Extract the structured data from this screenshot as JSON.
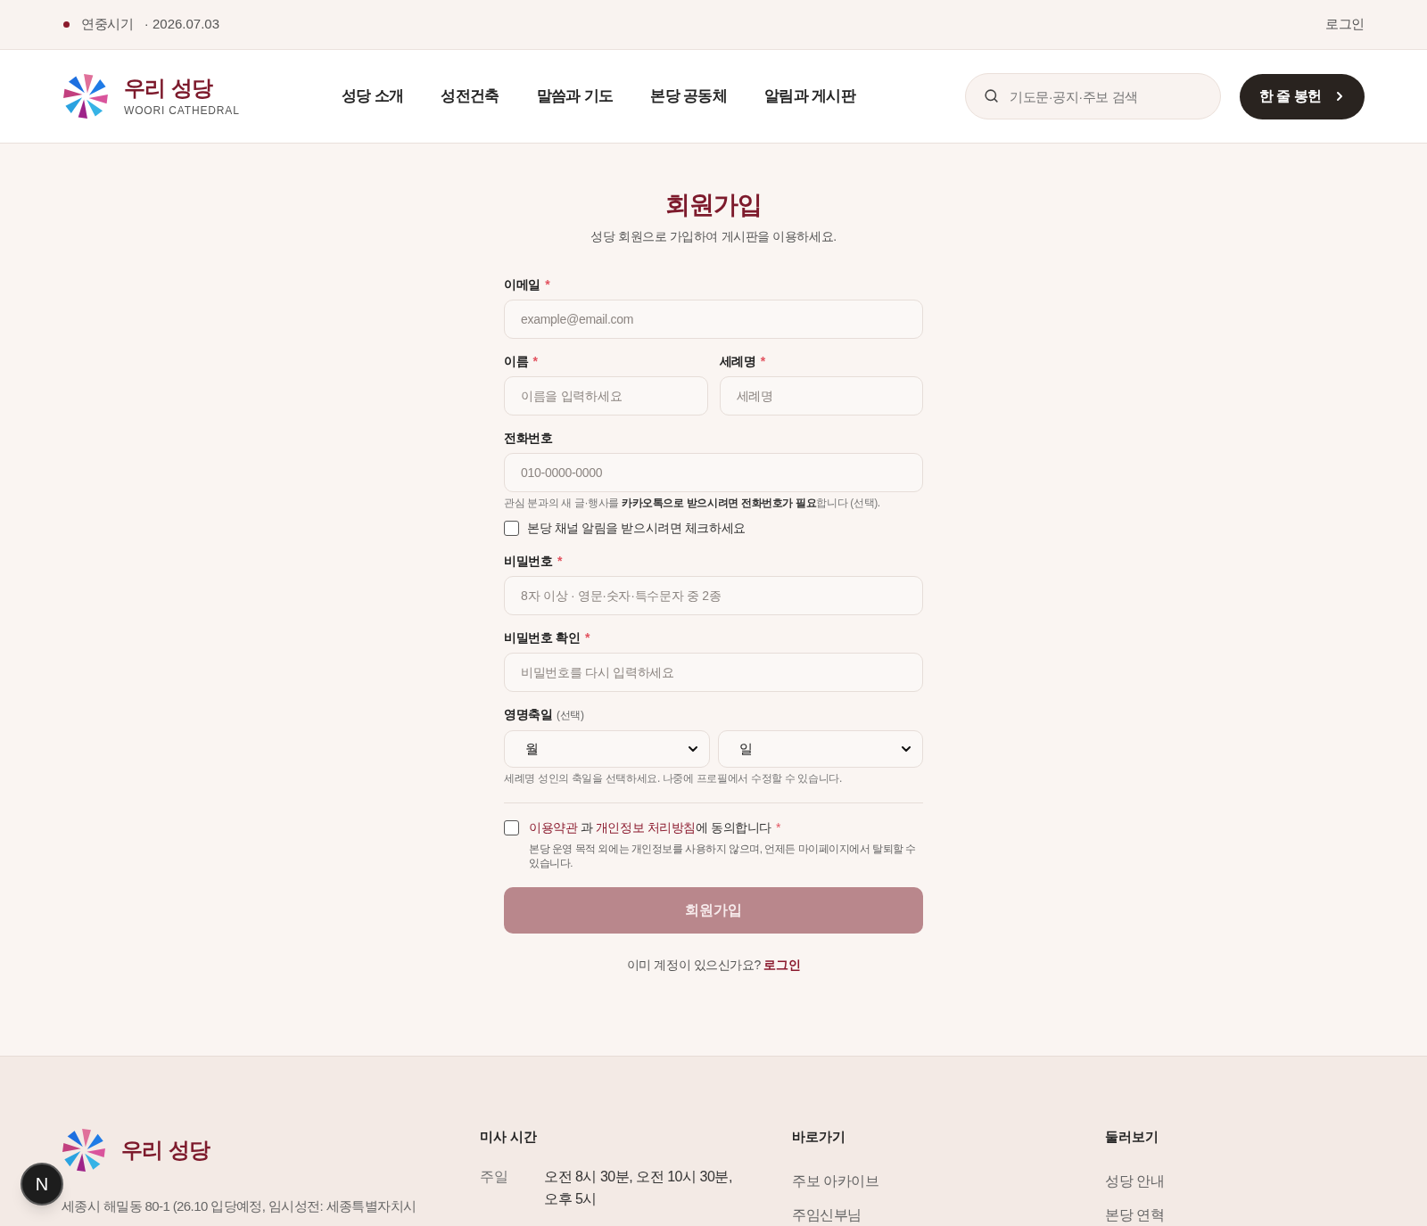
{
  "top_bar": {
    "season": "연중시기",
    "date": "· 2026.07.03",
    "login": "로그인"
  },
  "header": {
    "logo": {
      "name": "우리 성당",
      "subtitle": "WOORI CATHEDRAL"
    },
    "nav": [
      "성당 소개",
      "성전건축",
      "말씀과 기도",
      "본당 공동체",
      "알림과 게시판"
    ],
    "search": {
      "placeholder": "기도문·공지·주보 검색"
    },
    "cta": "한 줄 봉헌"
  },
  "signup": {
    "title": "회원가입",
    "subtitle": "성당 회원으로 가입하여 게시판을 이용하세요.",
    "rows": [
      {
        "kind": "input",
        "label": "이메일",
        "mark": "*",
        "placeholder": "example@email.com"
      },
      {
        "kind": "pair",
        "items": [
          {
            "label": "이름",
            "mark": "*",
            "placeholder": "이름을 입력하세요"
          },
          {
            "label": "세례명",
            "mark": "*",
            "placeholder": "세례명"
          }
        ]
      },
      {
        "kind": "input",
        "label": "전화번호",
        "placeholder": "010-0000-0000",
        "hint": "관심 분과의 새 글·행사를 **카카오톡으로 받으시려면 전화번호가 필요**합니다 (선택)."
      },
      {
        "kind": "checkbox",
        "label": "본당 채널 알림을 받으시려면 체크하세요",
        "checked": false
      },
      {
        "kind": "input",
        "label": "비밀번호",
        "mark": "*",
        "placeholder": "8자 이상 · 영문·숫자·특수문자 중 2종"
      },
      {
        "kind": "input",
        "label": "비밀번호 확인",
        "mark": "*",
        "placeholder": "비밀번호를 다시 입력하세요"
      },
      {
        "kind": "selects",
        "label": "영명축일",
        "note": "(선택)",
        "selects": [
          "월",
          "일"
        ],
        "hint": "세례명 성인의 축일을 선택하세요. 나중에 프로필에서 수정할 수 있습니다."
      }
    ],
    "consent": {
      "checked": false,
      "parts": [
        {
          "kind": "link",
          "text": "이용약관"
        },
        {
          "kind": "text",
          "text": " 과 "
        },
        {
          "kind": "link",
          "text": "개인정보 처리방침"
        },
        {
          "kind": "text",
          "text": "에 동의합니다"
        }
      ],
      "mark": "*",
      "description": "본당 운영 목적 외에는 개인정보를 사용하지 않으며, 언제든 마이페이지에서 탈퇴할 수 있습니다."
    },
    "submit": {
      "label": "회원가입",
      "disabled": true
    },
    "login_prompt": {
      "text": "이미 계정이 있으신가요?",
      "link": "로그인"
    }
  },
  "footer": {
    "logo": {
      "name": "우리 성당"
    },
    "address": "세종시 해밀동 80-1 (26.10 입당예정, 임시성전: 세종특별자치시",
    "mass": {
      "title": "미사 시간",
      "rows": [
        {
          "day": "주일",
          "times": "오전 8시 30분, 오전 10시 30분, 오후 5시"
        }
      ]
    },
    "quick_links": {
      "title": "바로가기",
      "items": [
        "주보 아카이브",
        "주임신부님"
      ]
    },
    "explore": {
      "title": "둘러보기",
      "items": [
        "성당 안내",
        "본당 연혁"
      ]
    }
  },
  "dev_badge": "N"
}
